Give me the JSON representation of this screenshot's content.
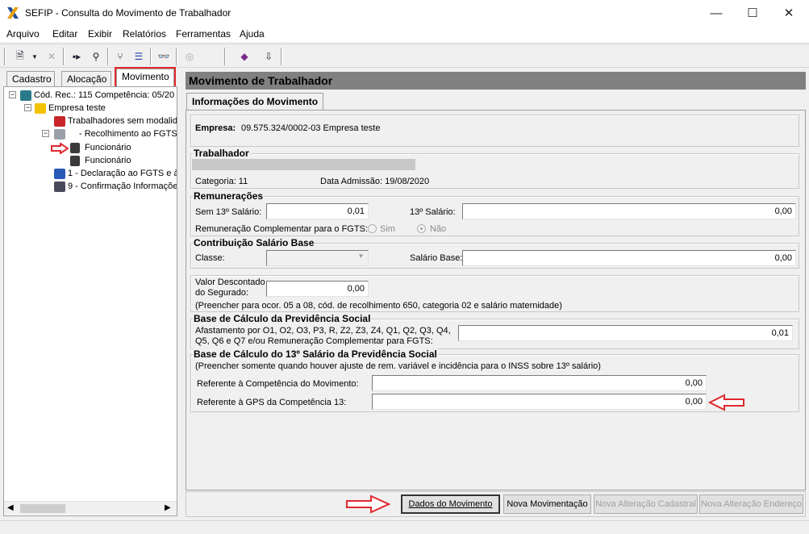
{
  "window": {
    "title": "SEFIP - Consulta do Movimento de Trabalhador",
    "minimize": "—",
    "maximize": "☐",
    "close": "✕"
  },
  "menu": [
    "Arquivo",
    "Editar",
    "Exibir",
    "Relatórios",
    "Ferramentas",
    "Ajuda"
  ],
  "left_tabs": {
    "cadastro": "Cadastro",
    "alocacao": "Alocação",
    "movimento": "Movimento"
  },
  "tree": {
    "root": "Cód. Rec.: 115 Competência: 05/20",
    "empresa": "Empresa teste",
    "sem_modalidade": "Trabalhadores sem modalid",
    "recolhimento": "- Recolhimento ao FGTS",
    "funcionario1": "Funcionário",
    "funcionario2": "Funcionário",
    "declaracao": "1 - Declaração ao FGTS e à",
    "confirmacao": "9 - Confirmação Informaçõe"
  },
  "main": {
    "header": "Movimento de Trabalhador",
    "tab": "Informações do Movimento",
    "empresa_label": "Empresa:",
    "empresa_value": "09.575.324/0002-03  Empresa teste",
    "trabalhador": {
      "title": "Trabalhador",
      "categoria": "Categoria: 11",
      "admissao": "Data Admissão: 19/08/2020"
    },
    "remuneracoes": {
      "title": "Remunerações",
      "sem13_label": "Sem 13º Salário:",
      "sem13_value": "0,01",
      "s13_label": "13º Salário:",
      "s13_value": "0,00",
      "complementar_label": "Remuneração Complementar para o FGTS:",
      "sim": "Sim",
      "nao": "Não"
    },
    "contribuicao": {
      "title": "Contribuição Salário Base",
      "classe_label": "Classe:",
      "salario_base_label": "Salário Base:",
      "salario_base_value": "0,00"
    },
    "valor_descontado": {
      "label1": "Valor Descontado",
      "label2": "do Segurado:",
      "value": "0,00",
      "note": "(Preencher para ocor. 05 a 08, cód. de recolhimento 650, categoria 02 e salário maternidade)"
    },
    "base_prev": {
      "title": "Base de Cálculo da Previdência Social",
      "line1": "Afastamento por O1, O2, O3, P3, R, Z2, Z3, Z4, Q1, Q2, Q3, Q4,",
      "line2": "Q5, Q6 e Q7  e/ou Remuneração Complementar para FGTS:",
      "value": "0,01"
    },
    "base13": {
      "title": "Base de Cálculo do 13º Salário da Previdência Social",
      "note": "(Preencher somente quando houver ajuste de rem. variável e incidência para o INSS sobre 13º salário)",
      "competencia_label": "Referente à Competência do Movimento:",
      "competencia_value": "0,00",
      "gps_label": "Referente à GPS da Competência 13:",
      "gps_value": "0,00"
    }
  },
  "buttons": {
    "dados": "Dados do Movimento",
    "nova_mov": "Nova Movimentação",
    "nova_alt_cad": "Nova Alteração Cadastral",
    "nova_alt_end": "Nova Alteração Endereço"
  },
  "colors": {
    "highlight_red": "#e0282e",
    "header_gray": "#808080"
  }
}
